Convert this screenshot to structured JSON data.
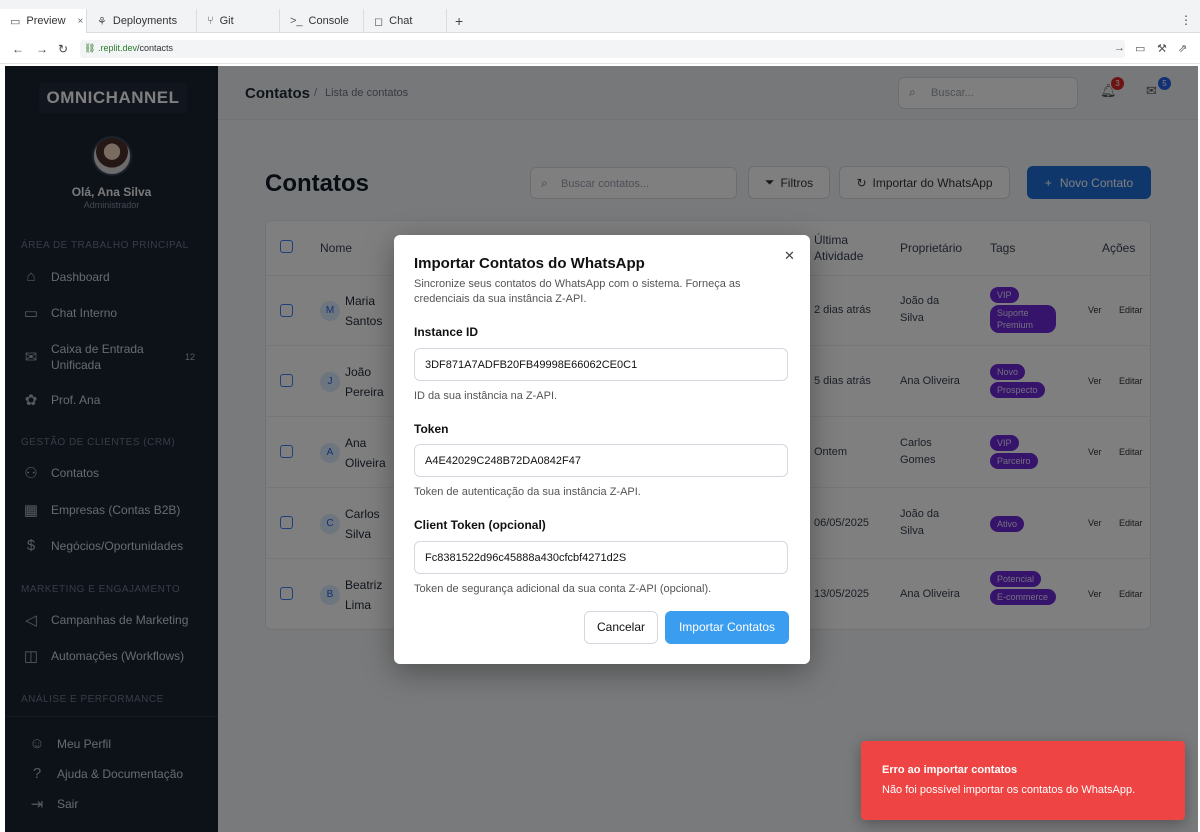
{
  "browser": {
    "tabs": [
      {
        "label": "Preview",
        "icon": "monitor-icon"
      },
      {
        "label": "Deployments",
        "icon": "deploy-icon"
      },
      {
        "label": "Git",
        "icon": "git-icon"
      },
      {
        "label": "Console",
        "icon": "console-icon"
      },
      {
        "label": "Chat",
        "icon": "chat-icon"
      }
    ],
    "url_domain": ".replit.dev",
    "url_path": "/contacts"
  },
  "sidebar": {
    "logo": "OMNICHANNEL",
    "greeting": "Olá, Ana Silva",
    "role": "Administrador",
    "sections": [
      {
        "title": "ÁREA DE TRABALHO PRINCIPAL"
      },
      {
        "title": "GESTÃO DE CLIENTES (CRM)"
      },
      {
        "title": "MARKETING E ENGAJAMENTO"
      },
      {
        "title": "ANÁLISE E PERFORMANCE"
      }
    ],
    "items": [
      {
        "label": "Dashboard",
        "icon": "home-icon"
      },
      {
        "label": "Chat Interno",
        "icon": "chat-icon"
      },
      {
        "label": "Caixa de Entrada Unificada",
        "icon": "inbox-icon",
        "badge": "12"
      },
      {
        "label": "Prof. Ana",
        "icon": "brain-icon"
      },
      {
        "label": "Contatos",
        "icon": "users-icon"
      },
      {
        "label": "Empresas (Contas B2B)",
        "icon": "building-icon"
      },
      {
        "label": "Negócios/Oportunidades",
        "icon": "dollar-icon"
      },
      {
        "label": "Campanhas de Marketing",
        "icon": "megaphone-icon"
      },
      {
        "label": "Automações (Workflows)",
        "icon": "bot-icon"
      }
    ],
    "footer": [
      {
        "label": "Meu Perfil",
        "icon": "user-icon"
      },
      {
        "label": "Ajuda & Documentação",
        "icon": "help-icon"
      },
      {
        "label": "Sair",
        "icon": "logout-icon"
      }
    ]
  },
  "header": {
    "breadcrumb_title": "Contatos",
    "breadcrumb_sep": "/",
    "breadcrumb_sub": "Lista de contatos",
    "search_placeholder": "Buscar...",
    "notif_count": "3",
    "mail_count": "5"
  },
  "page": {
    "title": "Contatos",
    "search_placeholder": "Buscar contatos...",
    "filters_label": "Filtros",
    "import_label": "Importar do WhatsApp",
    "new_label": "Novo Contato"
  },
  "table": {
    "headers": {
      "name": "Nome",
      "last_activity": "Última Atividade",
      "owner": "Proprietário",
      "tags": "Tags",
      "actions": "Ações"
    },
    "rows": [
      {
        "initial": "M",
        "name": "Maria Santos",
        "last": "2 dias atrás",
        "owner": "João da Silva",
        "tags": [
          "VIP",
          "Suporte Premium"
        ]
      },
      {
        "initial": "J",
        "name": "João Pereira",
        "last": "5 dias atrás",
        "owner": "Ana Oliveira",
        "tags": [
          "Novo",
          "Prospecto"
        ]
      },
      {
        "initial": "A",
        "name": "Ana Oliveira",
        "last": "Ontem",
        "owner": "Carlos Gomes",
        "tags": [
          "VIP",
          "Parceiro"
        ]
      },
      {
        "initial": "C",
        "name": "Carlos Silva",
        "last": "06/05/2025",
        "owner": "João da Silva",
        "tags": [
          "Ativo"
        ]
      },
      {
        "initial": "B",
        "name": "Beatriz Lima",
        "last": "13/05/2025",
        "owner": "Ana Oliveira",
        "tags": [
          "Potencial",
          "E-commerce"
        ]
      }
    ],
    "view_label": "Ver",
    "edit_label": "Editar"
  },
  "modal": {
    "title": "Importar Contatos do WhatsApp",
    "description": "Sincronize seus contatos do WhatsApp com o sistema. Forneça as credenciais da sua instância Z-API.",
    "instance_label": "Instance ID",
    "instance_value": "3DF871A7ADFB20FB49998E66062CE0C1",
    "instance_help": "ID da sua instância na Z-API.",
    "token_label": "Token",
    "token_value": "A4E42029C248B72DA0842F47",
    "token_help": "Token de autenticação da sua instância Z-API.",
    "client_label": "Client Token (opcional)",
    "client_value": "Fc8381522d96c45888a430cfcbf4271d2S",
    "client_help": "Token de segurança adicional da sua conta Z-API (opcional).",
    "cancel_label": "Cancelar",
    "import_label": "Importar Contatos"
  },
  "toast": {
    "title": "Erro ao importar contatos",
    "message": "Não foi possível importar os contatos do WhatsApp."
  },
  "colors": {
    "sidebar": "#1a2230",
    "primary": "#3b9df0",
    "toast": "#ef4444",
    "tag": "#6d28d9"
  }
}
